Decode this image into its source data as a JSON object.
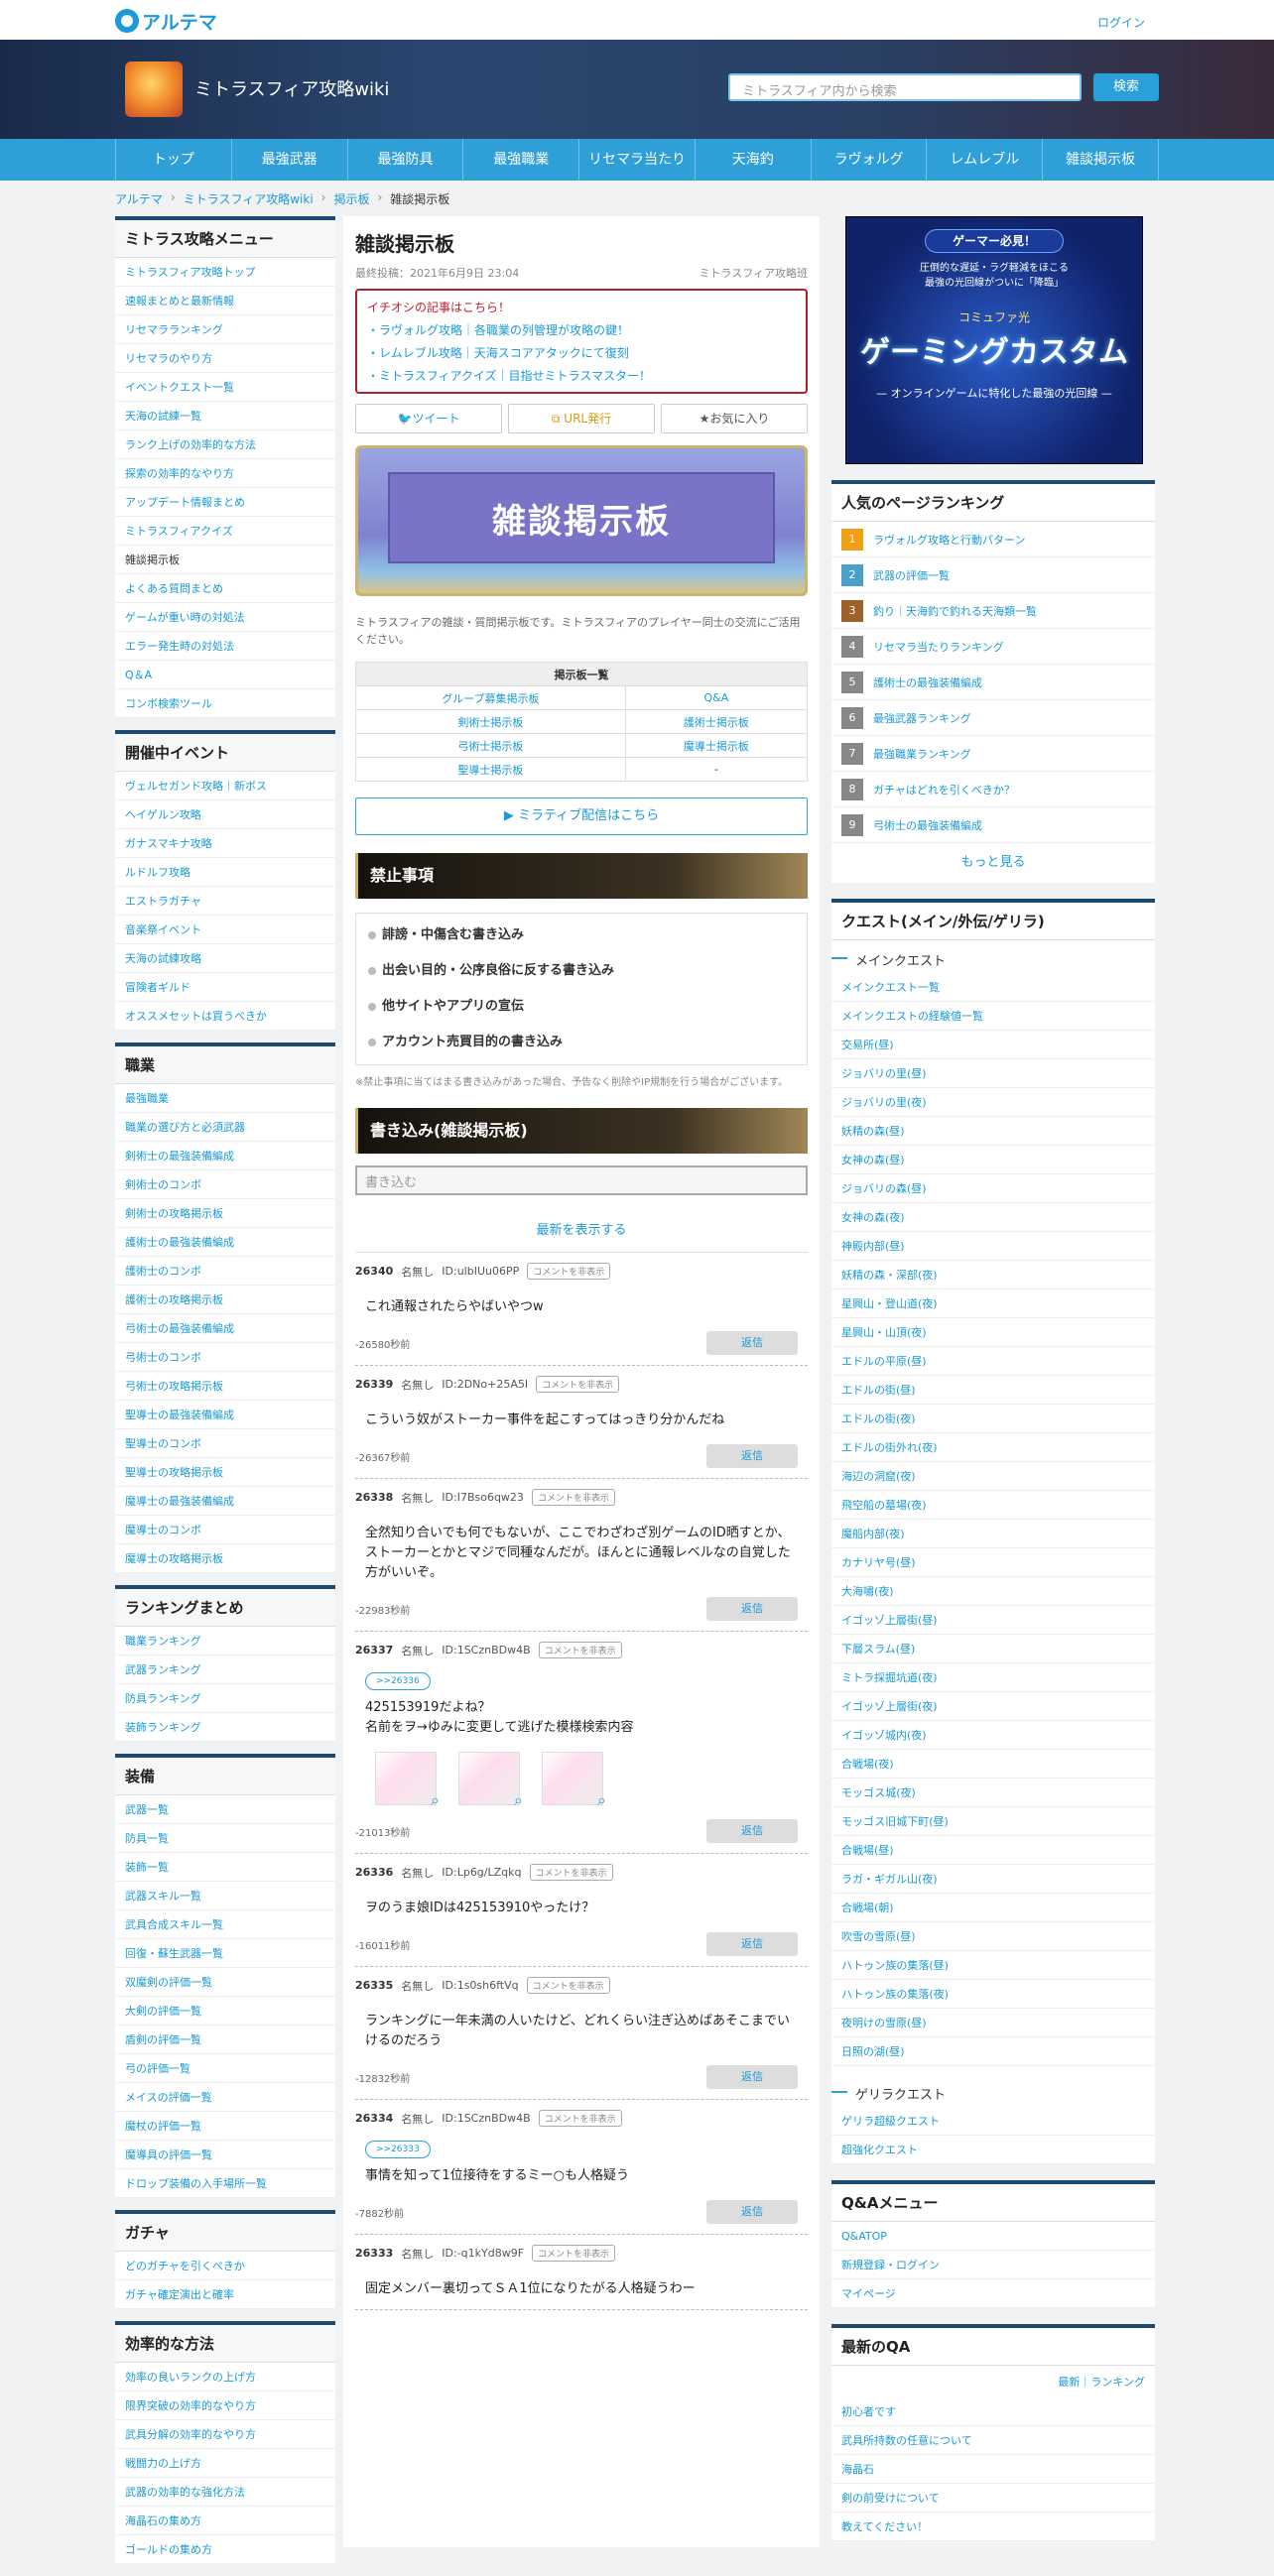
{
  "header": {
    "logo": "アルテマ",
    "login": "ログイン",
    "site_title": "ミトラスフィア攻略wiki",
    "search_placeholder": "ミトラスフィア内から検索",
    "search_button": "検索"
  },
  "nav": [
    "トップ",
    "最強武器",
    "最強防具",
    "最強職業",
    "リセマラ当たり",
    "天海釣",
    "ラヴォルグ",
    "レムレブル",
    "雑談掲示板"
  ],
  "breadcrumb": [
    "アルテマ",
    "ミトラスフィア攻略wiki",
    "掲示板",
    "雑談掲示板"
  ],
  "left": [
    {
      "title": "ミトラス攻略メニュー",
      "items": [
        "ミトラスフィア攻略トップ",
        "速報まとめと最新情報",
        "リセマラランキング",
        "リセマラのやり方",
        "イベントクエスト一覧",
        "天海の試練一覧",
        "ランク上げの効率的な方法",
        "探索の効率的なやり方",
        "アップデート情報まとめ",
        "ミトラスフィアクイズ",
        "雑談掲示板",
        "よくある質問まとめ",
        "ゲームが重い時の対処法",
        "エラー発生時の対処法",
        "Q＆A",
        "コンボ検索ツール"
      ]
    },
    {
      "title": "開催中イベント",
      "items": [
        "ヴェルセガンド攻略｜新ボス",
        "ヘイゲルン攻略",
        "ガナスマキナ攻略",
        "ルドルフ攻略",
        "エストラガチャ",
        "音楽祭イベント",
        "天海の試練攻略",
        "冒険者ギルド",
        "オススメセットは買うべきか"
      ]
    },
    {
      "title": "職業",
      "items": [
        "最強職業",
        "職業の選び方と必須武器",
        "剣術士の最強装備編成",
        "剣術士のコンボ",
        "剣術士の攻略掲示板",
        "護術士の最強装備編成",
        "護術士のコンボ",
        "護術士の攻略掲示板",
        "弓術士の最強装備編成",
        "弓術士のコンボ",
        "弓術士の攻略掲示板",
        "聖導士の最強装備編成",
        "聖導士のコンボ",
        "聖導士の攻略掲示板",
        "魔導士の最強装備編成",
        "魔導士のコンボ",
        "魔導士の攻略掲示板"
      ]
    },
    {
      "title": "ランキングまとめ",
      "items": [
        "職業ランキング",
        "武器ランキング",
        "防具ランキング",
        "装飾ランキング"
      ]
    },
    {
      "title": "装備",
      "items": [
        "武器一覧",
        "防具一覧",
        "装飾一覧",
        "武器スキル一覧",
        "武具合成スキル一覧",
        "回復・蘇生武器一覧",
        "双魔剣の評価一覧",
        "大剣の評価一覧",
        "盾剣の評価一覧",
        "弓の評価一覧",
        "メイスの評価一覧",
        "魔杖の評価一覧",
        "魔導具の評価一覧",
        "ドロップ装備の入手場所一覧"
      ]
    },
    {
      "title": "ガチャ",
      "items": [
        "どのガチャを引くべきか",
        "ガチャ確定演出と確率"
      ]
    },
    {
      "title": "効率的な方法",
      "items": [
        "効率の良いランクの上げ方",
        "限界突破の効率的なやり方",
        "武具分解の効率的なやり方",
        "戦闘力の上げ方",
        "武器の効率的な強化方法",
        "海晶石の集め方",
        "ゴールドの集め方"
      ]
    }
  ],
  "main": {
    "title": "雑談掲示板",
    "posted": "最終投稿：2021年6月9日 23:04",
    "author": "ミトラスフィア攻略班",
    "notice_title": "イチオシの記事はこちら！",
    "notice_items": [
      "・ラヴォルグ攻略｜各職業の列管理が攻略の鍵！",
      "・レムレブル攻略｜天海スコアアタックにて復刻",
      "・ミトラスフィアクイズ｜目指せミトラスマスター！"
    ],
    "share": [
      "ツイート",
      "URL発行",
      "お気に入り"
    ],
    "hero_text": "雑談掲示板",
    "intro": "ミトラスフィアの雑談・質問掲示板です。ミトラスフィアのプレイヤー同士の交流にご活用ください。",
    "board_header": "掲示板一覧",
    "boards": [
      [
        "グループ募集掲示板",
        "Q&A"
      ],
      [
        "剣術士掲示板",
        "護術士掲示板"
      ],
      [
        "弓術士掲示板",
        "魔導士掲示板"
      ],
      [
        "聖導士掲示板",
        "-"
      ]
    ],
    "mira": "▶ ミラティブ配信はこちら",
    "rules_title": "禁止事項",
    "rules": [
      "誹謗・中傷含む書き込み",
      "出会い目的・公序良俗に反する書き込み",
      "他サイトやアプリの宣伝",
      "アカウント売買目的の書き込み"
    ],
    "rules_note": "※禁止事項に当てはまる書き込みがあった場合、予告なく削除やIP規制を行う場合がございます。",
    "write_title": "書き込み(雑談掲示板)",
    "write_placeholder": "書き込む",
    "latest": "最新を表示する",
    "reply": "返信",
    "tag": "コメントを非表示",
    "posts": [
      {
        "no": "26340",
        "name": "名無し",
        "id": "ID:ulbIUu06PP",
        "anchor": "",
        "body": "これ通報されたらやばいやつw",
        "time": "-26580秒前"
      },
      {
        "no": "26339",
        "name": "名無し",
        "id": "ID:2DNo+25A5I",
        "anchor": "",
        "body": "こういう奴がストーカー事件を起こすってはっきり分かんだね",
        "time": "-26367秒前"
      },
      {
        "no": "26338",
        "name": "名無し",
        "id": "ID:I7Bso6qw23",
        "anchor": "",
        "body": "全然知り合いでも何でもないが、ここでわざわざ別ゲームのID晒すとか、ストーカーとかとマジで同種なんだが。ほんとに通報レベルなの自覚した方がいいぞ。",
        "time": "-22983秒前"
      },
      {
        "no": "26337",
        "name": "名無し",
        "id": "ID:1SCznBDw4B",
        "anchor": ">>26336",
        "body": "425153919だよね？\n名前をヲ→ゆみに変更して逃げた模様検索内容",
        "time": "-21013秒前",
        "images": 3
      },
      {
        "no": "26336",
        "name": "名無し",
        "id": "ID:Lp6g/LZqkq",
        "anchor": "",
        "body": "ヲのうま娘IDは425153910やったけ？",
        "time": "-16011秒前"
      },
      {
        "no": "26335",
        "name": "名無し",
        "id": "ID:1s0sh6ftVq",
        "anchor": "",
        "body": "ランキングに一年未満の人いたけど、どれくらい注ぎ込めばあそこまでいけるのだろう",
        "time": "-12832秒前"
      },
      {
        "no": "26334",
        "name": "名無し",
        "id": "ID:1SCznBDw4B",
        "anchor": ">>26333",
        "body": "事情を知って1位接待をするミー○も人格疑う",
        "time": "-7882秒前"
      },
      {
        "no": "26333",
        "name": "名無し",
        "id": "ID:-q1kYd8w9F",
        "anchor": "",
        "body": "固定メンバー裏切ってＳＡ1位になりたがる人格疑うわー",
        "time": ""
      }
    ]
  },
  "right": {
    "ad": {
      "pill": "ゲーマー必見！",
      "sub": "圧倒的な遅延・ラグ軽減をほこる\n最強の光回線がついに「降臨」",
      "big": "ゲーミングカスタム",
      "brand": "コミュファ光",
      "cap": "— オンラインゲームに特化した最強の光回線 —"
    },
    "ranking_title": "人気のページランキング",
    "ranking": [
      "ラヴォルグ攻略と行動パターン",
      "武器の評価一覧",
      "釣り｜天海釣で釣れる天海類一覧",
      "リセマラ当たりランキング",
      "護術士の最強装備編成",
      "最強武器ランキング",
      "最強職業ランキング",
      "ガチャはどれを引くべきか？",
      "弓術士の最強装備編成"
    ],
    "ranking_colors": [
      "#f0a010",
      "#4aa0c8",
      "#a0602a",
      "#888888",
      "#888888",
      "#888888",
      "#888888",
      "#888888",
      "#888888"
    ],
    "more": "もっと見る",
    "quest_title": "クエスト(メイン/外伝/ゲリラ)",
    "main_quest": "メインクエスト",
    "quest_items": [
      "メインクエスト一覧",
      "メインクエストの経験値一覧",
      "交易所(昼)",
      "ジョバリの里(昼)",
      "ジョバリの里(夜)",
      "妖精の森(昼)",
      "女神の森(昼)",
      "ジョバリの森(昼)",
      "女神の森(夜)",
      "神殿内部(昼)",
      "妖精の森・深部(夜)",
      "星興山・登山道(夜)",
      "星興山・山頂(夜)",
      "エドルの平原(昼)",
      "エドルの街(昼)",
      "エドルの街(夜)",
      "エドルの街外れ(夜)",
      "海辺の洞窟(夜)",
      "飛空船の墓場(夜)",
      "魔船内部(夜)",
      "カナリヤ号(昼)",
      "大海嘯(夜)",
      "イゴッゾ上層街(昼)",
      "下層スラム(昼)",
      "ミトラ採掘坑道(夜)",
      "イゴッゾ上層街(夜)",
      "イゴッゾ城内(夜)",
      "合戦場(夜)",
      "モッゴス城(夜)",
      "モッゴス旧城下町(昼)",
      "合戦場(昼)",
      "ラガ・ギガル山(夜)",
      "合戦場(朝)",
      "吹雪の雪原(昼)",
      "ハトゥン族の集落(昼)",
      "ハトゥン族の集落(夜)",
      "夜明けの雪原(昼)",
      "日照の湖(昼)"
    ],
    "guerrilla": "ゲリラクエスト",
    "guerrilla_items": [
      "ゲリラ超級クエスト",
      "超強化クエスト"
    ],
    "qa_title": "Q&Aメニュー",
    "qa_items": [
      "Q&ATOP",
      "新規登録・ログイン",
      "マイページ"
    ],
    "latest_qa_title": "最新のQA",
    "latest_qa_links": "最新｜ランキング",
    "latest_qa": [
      "初心者です",
      "武具所持数の任意について",
      "海晶石",
      "剣の前受けについて",
      "教えてください！"
    ]
  }
}
